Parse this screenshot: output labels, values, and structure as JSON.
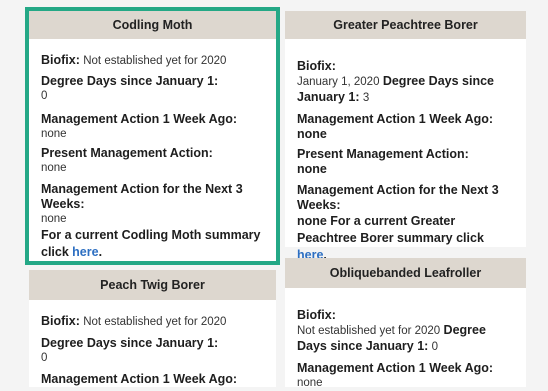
{
  "cards": {
    "codling": {
      "title": "Codling Moth",
      "biofix_label": "Biofix:",
      "biofix_value": "Not established yet for 2020",
      "dd_label": "Degree Days since January 1:",
      "dd_value": "0",
      "mgmt_prev_label": "Management Action 1 Week Ago:",
      "mgmt_prev_value": "none",
      "mgmt_now_label": "Present Management Action:",
      "mgmt_now_value": "none",
      "mgmt_next_label": "Management Action for the Next 3 Weeks:",
      "mgmt_next_value": "none",
      "summary_text": "For a current Codling Moth summary click",
      "summary_link": "here",
      "summary_end": "."
    },
    "peachtree": {
      "title": "Greater Peachtree Borer",
      "biofix_label": "Biofix:",
      "biofix_value": "January 1, 2020",
      "dd_label": "Degree Days since January 1:",
      "dd_value": "3",
      "mgmt_prev_label": "Management Action 1 Week Ago:",
      "mgmt_prev_value": "none",
      "mgmt_now_label": "Present Management Action:",
      "mgmt_now_value": "none",
      "mgmt_next_label": "Management Action for the Next 3 Weeks:",
      "mgmt_next_value": "none",
      "summary_text": "For a current Greater Peachtree Borer summary click",
      "summary_link": "here",
      "summary_end": "."
    },
    "twig": {
      "title": "Peach Twig Borer",
      "biofix_label": "Biofix:",
      "biofix_value": "Not established yet for 2020",
      "dd_label": "Degree Days since January 1:",
      "dd_value": "0",
      "mgmt_prev_label": "Management Action 1 Week Ago:"
    },
    "leafroller": {
      "title": "Obliquebanded Leafroller",
      "biofix_label": "Biofix:",
      "biofix_value": "Not established yet for 2020",
      "dd_label": "Degree Days since January 1:",
      "dd_value": "0",
      "mgmt_prev_label": "Management Action 1 Week Ago:",
      "mgmt_prev_value": "none"
    }
  },
  "colors": {
    "highlight_border": "#24a886",
    "header_bg": "#ddd7cf",
    "link": "#2d6fc2"
  }
}
